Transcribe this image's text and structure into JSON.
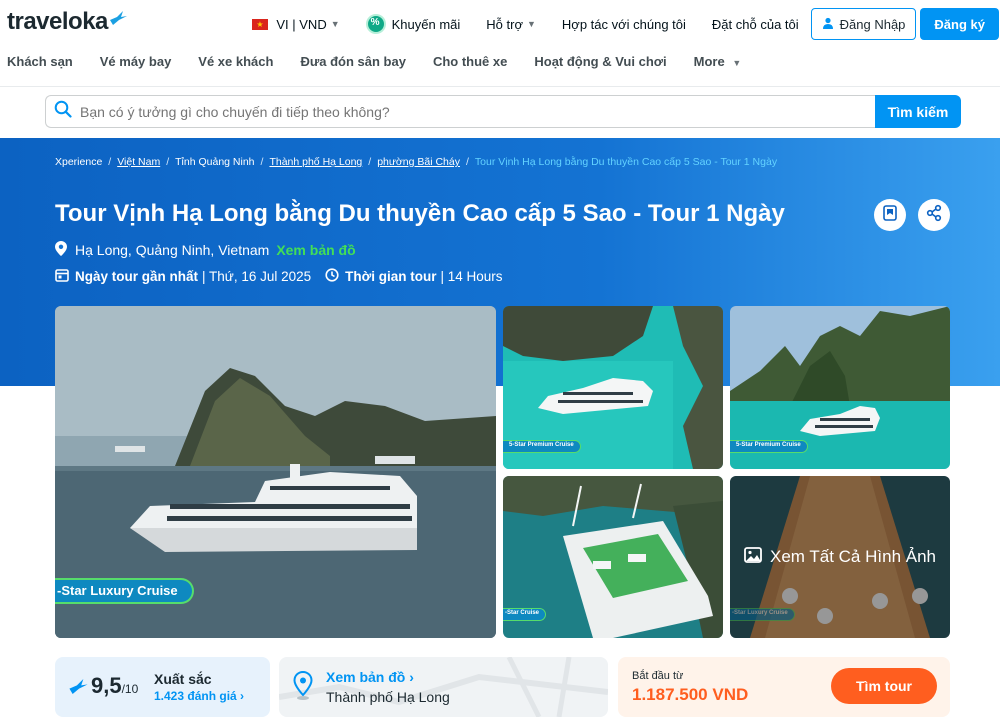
{
  "header": {
    "logo_text": "traveloka",
    "language": "VI | VND",
    "promo": "Khuyến mãi",
    "support": "Hỗ trợ",
    "partner": "Hợp tác với chúng tôi",
    "bookings": "Đặt chỗ của tôi",
    "login": "Đăng Nhập",
    "register": "Đăng ký"
  },
  "nav": {
    "items": [
      "Khách sạn",
      "Vé máy bay",
      "Vé xe khách",
      "Đưa đón sân bay",
      "Cho thuê xe",
      "Hoạt động & Vui chơi",
      "More"
    ]
  },
  "search": {
    "placeholder": "Bạn có ý tưởng gì cho chuyến đi tiếp theo không?",
    "button": "Tìm kiếm"
  },
  "breadcrumb": {
    "items": [
      "Xperience",
      "Việt Nam",
      "Tỉnh Quảng Ninh",
      "Thành phố Hạ Long",
      "phường Bãi Cháy"
    ],
    "current": "Tour Vịnh Hạ Long bằng Du thuyền Cao cấp 5 Sao - Tour 1 Ngày"
  },
  "tour": {
    "title": "Tour Vịnh Hạ Long bằng Du thuyền Cao cấp 5 Sao - Tour 1 Ngày",
    "location": "Hạ Long, Quảng Ninh, Vietnam",
    "map_link": "Xem bản đồ",
    "nearest_label": "Ngày tour gần nhất",
    "nearest_value": "| Thứ, 16 Jul 2025",
    "duration_label": "Thời gian tour",
    "duration_value": "| 14 Hours"
  },
  "gallery": {
    "main_badge": "-Star Luxury Cruise",
    "badge_2": "5-Star Premium Cruise",
    "badge_3": "5-Star Premium Cruise",
    "badge_4": "-Star Cruise",
    "badge_5": "-Star Luxury Cruise",
    "view_all": "Xem Tất Cả Hình Ảnh"
  },
  "rating": {
    "score": "9,5",
    "max": "/10",
    "label": "Xuất sắc",
    "count": "1.423 đánh giá"
  },
  "map_card": {
    "link": "Xem bản đồ",
    "city": "Thành phố Hạ Long"
  },
  "price": {
    "label": "Bắt đầu từ",
    "value": "1.187.500 VND",
    "button": "Tìm tour"
  },
  "colors": {
    "brand": "#0194f3",
    "hero_blue": "#1473d3",
    "accent_orange": "#ff5e1f",
    "accent_green": "#43df56"
  }
}
